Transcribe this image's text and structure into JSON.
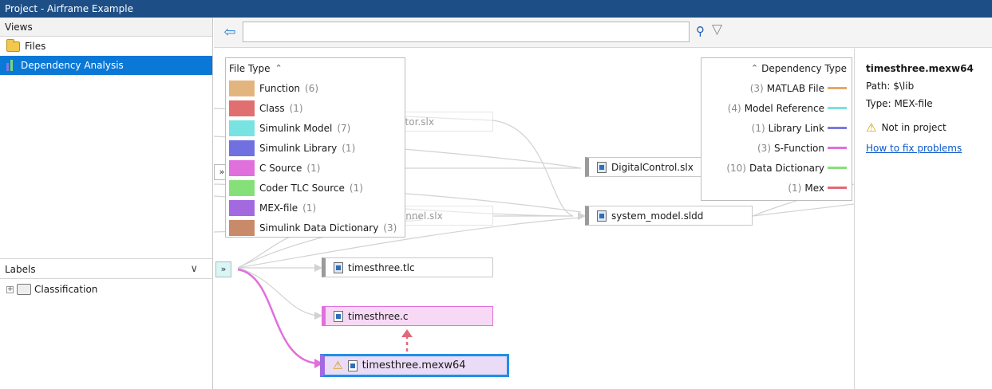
{
  "window": {
    "title": "Project - Airframe Example"
  },
  "views": {
    "header": "Views",
    "items": [
      {
        "label": "Files",
        "icon": "folder-icon",
        "selected": false
      },
      {
        "label": "Dependency Analysis",
        "icon": "dependency-icon",
        "selected": true
      }
    ]
  },
  "labels": {
    "header": "Labels",
    "item": "Classification"
  },
  "search": {
    "value": "",
    "placeholder": ""
  },
  "file_type": {
    "header": "File Type",
    "toggle": "«",
    "items": [
      {
        "label": "Function",
        "count": "(6)",
        "color": "#e3b57e"
      },
      {
        "label": "Class",
        "count": "(1)",
        "color": "#e07070"
      },
      {
        "label": "Simulink Model",
        "count": "(7)",
        "color": "#78e3e0"
      },
      {
        "label": "Simulink Library",
        "count": "(1)",
        "color": "#7070e0"
      },
      {
        "label": "C Source",
        "count": "(1)",
        "color": "#e070dc"
      },
      {
        "label": "Coder TLC Source",
        "count": "(1)",
        "color": "#86e07a"
      },
      {
        "label": "MEX-file",
        "count": "(1)",
        "color": "#a36ae0"
      },
      {
        "label": "Simulink Data Dictionary",
        "count": "(3)",
        "color": "#c98a6a"
      }
    ]
  },
  "dependency_type": {
    "header": "Dependency Type",
    "items": [
      {
        "count": "(3)",
        "label": "MATLAB File",
        "color": "#e8a865"
      },
      {
        "count": "(4)",
        "label": "Model Reference",
        "color": "#78e3e0"
      },
      {
        "count": "(1)",
        "label": "Library Link",
        "color": "#7a7ae0"
      },
      {
        "count": "(3)",
        "label": "S-Function",
        "color": "#e070dc"
      },
      {
        "count": "(10)",
        "label": "Data Dictionary",
        "color": "#86e07a"
      },
      {
        "count": "(1)",
        "label": "Mex",
        "color": "#e06a7a"
      }
    ]
  },
  "graph_nodes": {
    "linear_actuator": "LinearActuator.slx",
    "digital_control": "DigitalControl.slx",
    "vertical_channel": "vertical_channel.slx",
    "system_model": "system_model.sldd",
    "tlc": "timesthree.tlc",
    "c_source": "timesthree.c",
    "mex": "timesthree.mexw64"
  },
  "details": {
    "title": "timesthree.mexw64",
    "path_label": "Path:",
    "path_value": "$\\lib",
    "type_label": "Type:",
    "type_value": "MEX-file",
    "warning": "Not in project",
    "link": "How to fix problems"
  }
}
